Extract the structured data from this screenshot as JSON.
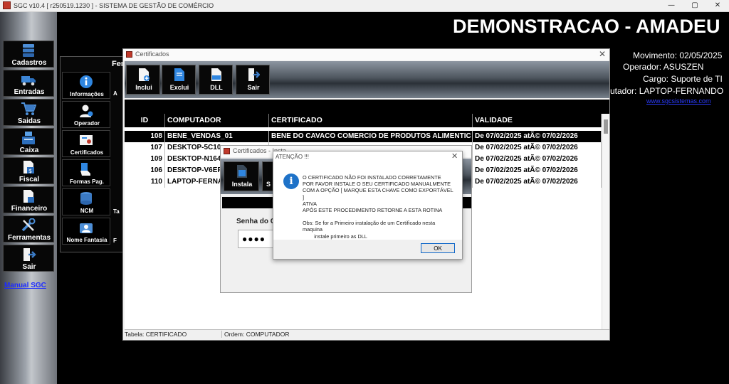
{
  "window": {
    "title": "SGC v10.4 [ r250519.1230 ] - SISTEMA DE GESTÃO DE COMÉRCIO",
    "min": "—",
    "max": "▢",
    "close": "✕"
  },
  "sidebar": {
    "items": [
      {
        "label": "Cadastros",
        "icon": "database-icon"
      },
      {
        "label": "Entradas",
        "icon": "truck-icon"
      },
      {
        "label": "Saidas",
        "icon": "cart-icon"
      },
      {
        "label": "Caixa",
        "icon": "register-icon"
      },
      {
        "label": "Fiscal",
        "icon": "fiscal-doc-icon"
      },
      {
        "label": "Financeiro",
        "icon": "finance-doc-icon"
      },
      {
        "label": "Ferramentas",
        "icon": "tools-icon"
      },
      {
        "label": "Sair",
        "icon": "exit-icon"
      }
    ],
    "manual": "Manual SGC"
  },
  "header": {
    "headline": "DEMONSTRACAO - AMADEU",
    "movimento": "Movimento: 02/05/2025",
    "operador": "Operador: ASUSZEN",
    "cargo": "Cargo: Suporte de TI",
    "computador": "utador: LAPTOP-FERNANDO",
    "site": "www.sgcsistemas.com"
  },
  "ferramentas": {
    "title": "Fer",
    "items": [
      {
        "label": "Informações",
        "icon": "info-icon"
      },
      {
        "label": "Operador",
        "icon": "operator-icon"
      },
      {
        "label": "Certificados",
        "icon": "certificate-icon"
      },
      {
        "label": "Formas Pag.",
        "icon": "payment-icon"
      },
      {
        "label": "NCM",
        "icon": "ncm-db-icon"
      },
      {
        "label": "Nome Fantasia",
        "icon": "fantasy-name-icon"
      }
    ],
    "side_fragments": [
      "A",
      "Ta",
      "F"
    ]
  },
  "certificados": {
    "title": "Certificados",
    "toolbar": [
      {
        "label": "Inclui",
        "icon": "add-doc-icon"
      },
      {
        "label": "Exclui",
        "icon": "delete-doc-icon"
      },
      {
        "label": "DLL",
        "icon": "dll-icon"
      },
      {
        "label": "Sair",
        "icon": "exit-icon"
      }
    ],
    "columns": [
      "ID",
      "COMPUTADOR",
      "CERTIFICADO",
      "VALIDADE"
    ],
    "rows": [
      {
        "id": "108",
        "computador": "BENE_VENDAS_01",
        "certificado": "BENE DO CAVACO COMERCIO DE PRODUTOS ALIMENTIC",
        "validade": "De 07/02/2025 atÃ© 07/02/2026",
        "selected": true
      },
      {
        "id": "107",
        "computador": "DESKTOP-5C10",
        "certificado": "",
        "validade": "De 07/02/2025 atÃ© 07/02/2026",
        "selected": false
      },
      {
        "id": "109",
        "computador": "DESKTOP-N164",
        "certificado": "",
        "validade": "De 07/02/2025 atÃ© 07/02/2026",
        "selected": false
      },
      {
        "id": "106",
        "computador": "DESKTOP-V6EF",
        "certificado": "",
        "validade": "De 07/02/2025 atÃ© 07/02/2026",
        "selected": false
      },
      {
        "id": "110",
        "computador": "LAPTOP-FERNA",
        "certificado": "",
        "validade": "De 07/02/2025 atÃ© 07/02/2026",
        "selected": false
      }
    ],
    "status_table": "Tabela: CERTIFICADO",
    "status_order": "Ordem: COMPUTADOR"
  },
  "instala": {
    "title": "Certificados - Insta",
    "button": "Instala",
    "button2": "S",
    "senha_label": "Senha do Ce",
    "password_mask": "●●●●"
  },
  "alert": {
    "title": "ATENÇÃO !!!",
    "lines": [
      "O CERTIFICADO NÃO FOI INSTALADO CORRETAMENTE",
      "POR FAVOR INSTALE O SEU CERTIFICADO MANUALMENTE",
      "COM A OPÇÃO [ MARQUE ESTA CHAVE COMO EXPORTÁVEL ]",
      "ATIVA",
      "APÓS ESTE PROCEDIMENTO RETORNE A ESTA ROTINA",
      "",
      "Obs: Se for a Primeiro instalação de um Certificado nesta",
      "maquina",
      "        instale primeiro as DLL"
    ],
    "ok": "OK"
  },
  "colors": {
    "sidebar_metal": "#9ea4ac",
    "link": "#1d2cff",
    "info_blue": "#1e72c8",
    "selected_row": "#000000"
  }
}
